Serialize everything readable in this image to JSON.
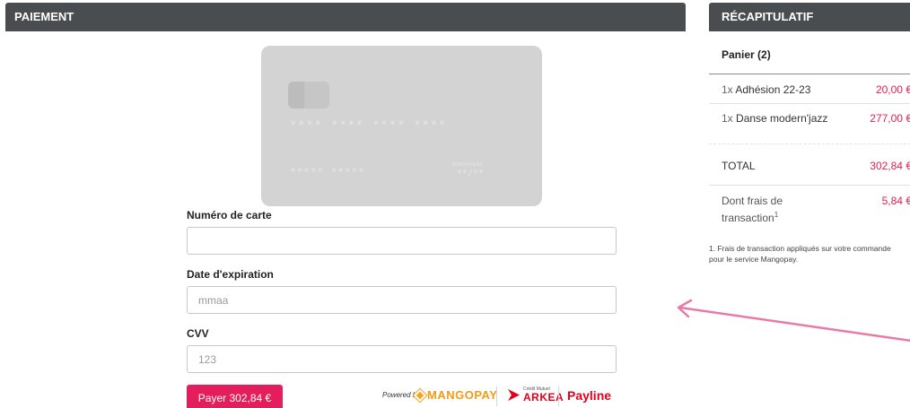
{
  "colors": {
    "header_bg": "#4a4d50",
    "accent": "#e41e5c",
    "price": "#e0204f",
    "card_bg": "#d3d3d3",
    "arrow": "#e87aa8"
  },
  "payment": {
    "header": "PAIEMENT",
    "card_preview": {
      "number": "**** **** **** ****",
      "holder": "***** *****",
      "valid_label": "MONTH/YEAR",
      "expiry": "**/**"
    },
    "fields": {
      "card_number": {
        "label": "Numéro de carte",
        "value": "",
        "placeholder": ""
      },
      "expiry": {
        "label": "Date d'expiration",
        "value": "",
        "placeholder": "mmaa"
      },
      "cvv": {
        "label": "CVV",
        "value": "",
        "placeholder": "123"
      }
    },
    "pay_button": "Payer 302,84 €",
    "logos": {
      "powered_by": "Powered by",
      "mangopay": "MANGOPAY",
      "arkea_small": "Crédit Mutuel",
      "arkea": "ARKEA",
      "payline": "Payline"
    }
  },
  "summary": {
    "header": "RÉCAPITULATIF",
    "cart_title": "Panier (2)",
    "items": [
      {
        "qty": "1x",
        "name": "Adhésion 22-23",
        "price": "20,00 €"
      },
      {
        "qty": "1x",
        "name": "Danse modern'jazz",
        "price": "277,00 €"
      }
    ],
    "total_label": "TOTAL",
    "total_value": "302,84 €",
    "fees_label": "Dont frais de transaction",
    "fees_note_ref": "1",
    "fees_value": "5,84 €",
    "footnote": "1. Frais de transaction appliqués sur votre commande pour le service Mangopay."
  }
}
